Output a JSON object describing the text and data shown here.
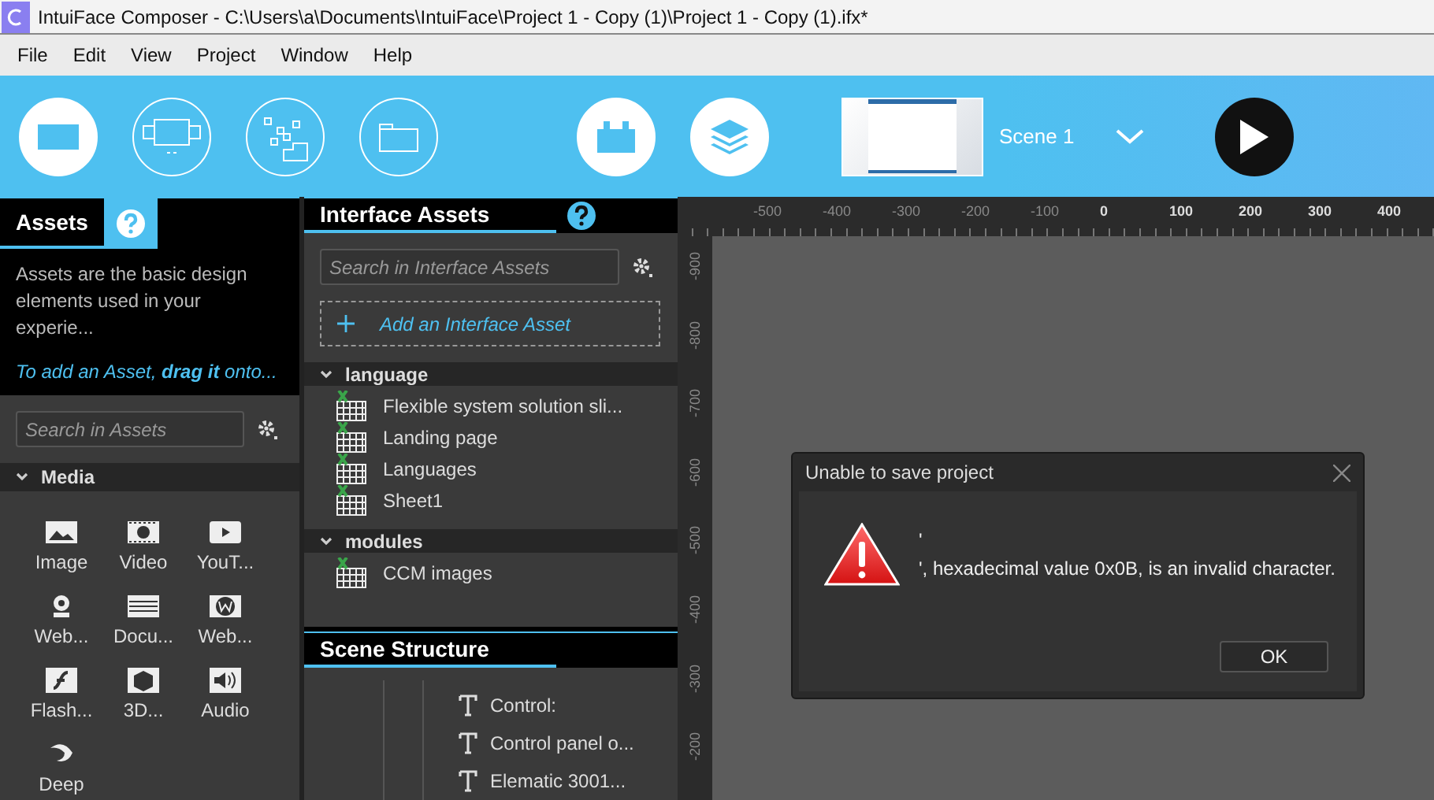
{
  "title_bar": {
    "title": "IntuiFace Composer - C:\\Users\\a\\Documents\\IntuiFace\\Project 1 - Copy (1)\\Project 1 - Copy (1).ifx*"
  },
  "menu": [
    "File",
    "Edit",
    "View",
    "Project",
    "Window",
    "Help"
  ],
  "toolbar": {
    "scene_label": "Scene 1"
  },
  "ruler": {
    "x_labels": [
      "-500",
      "-400",
      "-300",
      "-200",
      "-100",
      "0",
      "100",
      "200",
      "300",
      "400"
    ],
    "y_labels": [
      "-900",
      "-800",
      "-700",
      "-600",
      "-500",
      "-400",
      "-300",
      "-200"
    ]
  },
  "assets_panel": {
    "title": "Assets",
    "description": "Assets are the basic design elements used in your experie...",
    "hint": "To add an Asset, **drag it** onto...",
    "search_placeholder": "Search in Assets",
    "category": {
      "label": "Media",
      "expanded": true,
      "items": [
        {
          "label": "Image",
          "kind": "image"
        },
        {
          "label": "Video",
          "kind": "video"
        },
        {
          "label": "YouT...",
          "kind": "youtube"
        },
        {
          "label": "Web...",
          "kind": "webcam"
        },
        {
          "label": "Docu...",
          "kind": "document"
        },
        {
          "label": "Web...",
          "kind": "web"
        },
        {
          "label": "Flash...",
          "kind": "flash"
        },
        {
          "label": "3D...",
          "kind": "cube"
        },
        {
          "label": "Audio",
          "kind": "audio"
        },
        {
          "label": "Deep",
          "kind": "deep"
        }
      ]
    }
  },
  "interface_assets": {
    "title": "Interface Assets",
    "search_placeholder": "Search in Interface Assets",
    "add_label": "Add an Interface Asset",
    "groups": [
      {
        "label": "language",
        "expanded": true,
        "items": [
          {
            "label": "Flexible system solution sli..."
          },
          {
            "label": "Landing page"
          },
          {
            "label": "Languages"
          },
          {
            "label": "Sheet1"
          }
        ]
      },
      {
        "label": "modules",
        "expanded": true,
        "items": [
          {
            "label": "CCM images"
          }
        ]
      }
    ]
  },
  "scene_structure": {
    "title": "Scene Structure",
    "items": [
      {
        "label": "Control:"
      },
      {
        "label": "Control panel o..."
      },
      {
        "label": "Elematic 3001..."
      }
    ]
  },
  "dialog": {
    "title": "Unable to save project",
    "lines": [
      "'",
      "', hexadecimal value 0x0B, is an invalid character."
    ],
    "button": "OK"
  }
}
